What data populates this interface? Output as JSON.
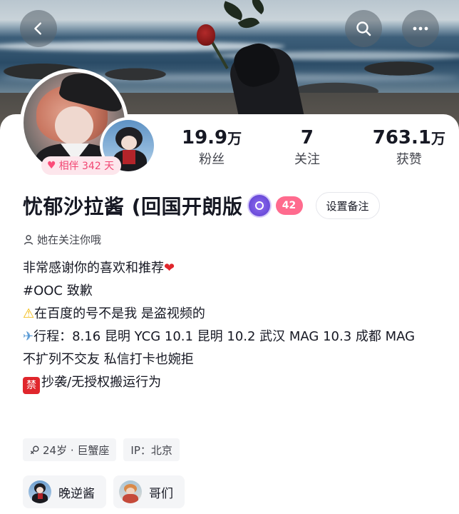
{
  "nav": {
    "back_icon": "chevron-left-icon",
    "search_icon": "search-icon",
    "more_icon": "more-horizontal-icon"
  },
  "profile": {
    "companion_days": "相伴 342 天",
    "name": "忧郁沙拉酱 (回国开朗版",
    "fan_level": "42",
    "remark_button": "设置备注",
    "follow_note": "她在关注你哦"
  },
  "stats": [
    {
      "value": "19.9",
      "unit": "万",
      "label": "粉丝"
    },
    {
      "value": "7",
      "unit": "",
      "label": "关注"
    },
    {
      "value": "763.1",
      "unit": "万",
      "label": "获赞"
    }
  ],
  "bio": {
    "line1": "非常感谢你的喜欢和推荐",
    "line2": "#OOC 致歉",
    "line3": "在百度的号不是我 是盗视频的",
    "line4": "行程：8.16 昆明 YCG 10.1 昆明 10.2 武汉 MAG 10.3 成都 MAG",
    "line5": "不扩列不交友 私信打卡也婉拒",
    "line6_badge": "禁",
    "line6": "抄袭/无授权搬运行为"
  },
  "tags": [
    {
      "text": "24岁 · 巨蟹座"
    },
    {
      "text": "IP：北京"
    }
  ],
  "friends": [
    {
      "name": "晚逆酱"
    },
    {
      "name": "哥们"
    }
  ],
  "colors": {
    "accent_pink": "#f14672",
    "level_purple": "#6a4bd9",
    "text_primary": "#161823",
    "text_secondary": "#43454d"
  }
}
